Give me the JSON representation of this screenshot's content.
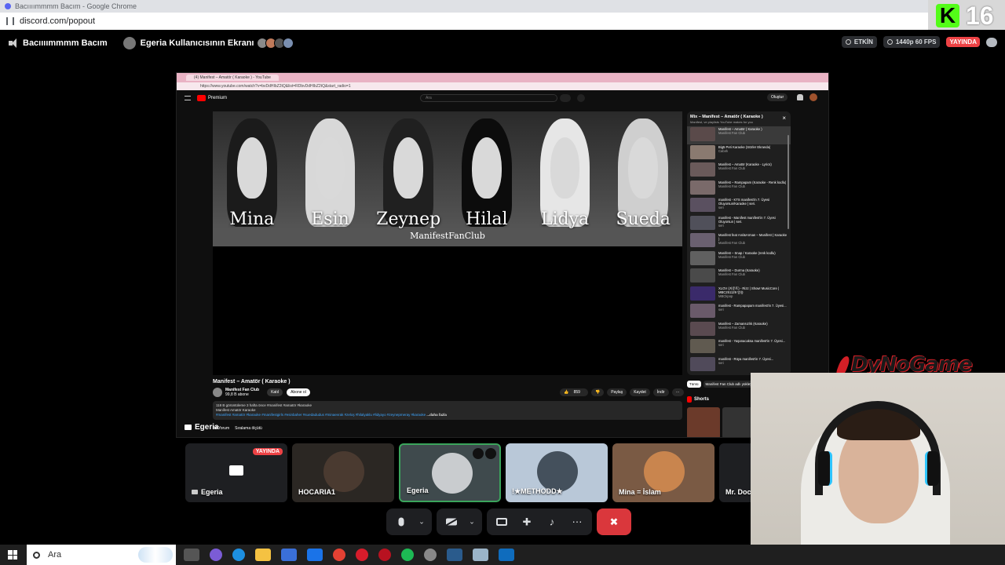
{
  "browser": {
    "title": "Bacıııımmmm Bacım - Google Chrome",
    "url": "discord.com/popout"
  },
  "kick_overlay": {
    "logo": "K",
    "number": "16"
  },
  "header": {
    "channel": "Bacıııımmmm Bacım",
    "screen_title": "Egeria Kullanıcısının Ekranı",
    "active_label": "ETKİN",
    "quality_label": "1440p 60 FPS",
    "live_label": "YAYINDA"
  },
  "stream": {
    "owner": "Egeria",
    "tab_title": "(4) Manifest – Amatör ( Karaoke ) - YouTube",
    "url": "https://www.youtube.com/watch?v=bvDdHIbZ2tQ&list=RDbvDdHIbZ2tQ&start_radio=1",
    "yt": {
      "logo": "Premium",
      "search_placeholder": "Ara",
      "create_label": "Oluştur",
      "banner_names": [
        "Mina",
        "Esin",
        "Zeynep",
        "Hilal",
        "Lidya",
        "Sueda"
      ],
      "banner_footer": "ManifestFanClub",
      "video_title": "Manifest – Amatör ( Karaoke )",
      "channel_name": "Manifest Fan Club",
      "channel_subs": "99,8 B abone",
      "join_label": "Katıl",
      "subscribe_label": "Abone ol",
      "likes": "859",
      "share_label": "Paylaş",
      "save_label": "Kaydet",
      "download_label": "İndir",
      "desc_line1": "118 B görüntüleme  3 hafta önce  #manifest #amatör #karaoke",
      "desc_line2": "Manifest Amatör Karaoke",
      "desc_tags": "#manifest #amatör #karaoke #manifestgirls #esinbaher #suedadudus #minaevrak #zeloş #hilalyaklu #lidyayo #zeynepmeray #karaoke",
      "desc_more": "...daha fazla",
      "comments_label": "34 Yorum",
      "sort_label": "Sıralama ölçütü",
      "mix_title": "Mix – Manifest – Amatör ( Karaoke )",
      "mix_sub": "Manifest, ve playlists YouTube makes for you",
      "playlist": [
        {
          "title": "Manifest – Amatör ( Karaoke )",
          "channel": "Manifest Fan Club"
        },
        {
          "title": "Big5 Peri Karaoke (Sözler Ekranda)",
          "channel": "Cabırlı"
        },
        {
          "title": "Manifest – Amatör (Karaoke - Lyrics)",
          "channel": "Manifest Fan Club"
        },
        {
          "title": "Manifest – Rampapam (Karaoke - Renk kodlu)",
          "channel": "Manifest Fan Club"
        },
        {
          "title": "manifest - KTS manifest'in 7. Üyesi Oluyorsun/Karaoke | seri.",
          "channel": "seri"
        },
        {
          "title": "manifest - Manifest manifest'in 7. Üyesi Oluyorsun | seri.",
          "channel": "seri"
        },
        {
          "title": "Manifest feat Anıl&Arman – Manifest ( Karaoke )",
          "channel": "Manifest Fan Club"
        },
        {
          "title": "Manifest – Snap / Karaoke (renk kodlu)",
          "channel": "Manifest Fan Club"
        },
        {
          "title": "Manifest – Durma (Karaoke)",
          "channel": "Manifest Fan Club"
        },
        {
          "title": "XLOV (카운트) - Rizz | Show! MusicCore | MBC251129 방송",
          "channel": "MBCkpop"
        },
        {
          "title": "manifest - Rampapapam manifest'in 7. Üyesi...",
          "channel": "seri"
        },
        {
          "title": "Manifest – Zamansızlık (Karaoke)",
          "channel": "Manifest Fan Club"
        },
        {
          "title": "manifest - Yaşanacaksa manifest'in 7. Üyesi...",
          "channel": "seri"
        },
        {
          "title": "manifest - Rüya manifest'in 7. Üyesi...",
          "channel": "seri"
        }
      ],
      "chip_all": "Tümü",
      "chip_channel": "Manifest Fan Club adlı yükleyiciden",
      "shorts_label": "Shorts"
    }
  },
  "tiles": [
    {
      "name": "Egeria",
      "live": "YAYINDA"
    },
    {
      "name": "HOCARIA1"
    },
    {
      "name": "Egeria"
    },
    {
      "name": "!★METHODD★"
    },
    {
      "name": "Mina = İslam"
    },
    {
      "name": "Mr. Doctor"
    }
  ],
  "overlay_brand": "DyNoGame",
  "taskbar": {
    "search_placeholder": "Ara"
  },
  "colors": {
    "discord_red": "#da373c",
    "live_red": "#ed4245",
    "selected_green": "#3ba55c",
    "kick_green": "#53fc18"
  }
}
